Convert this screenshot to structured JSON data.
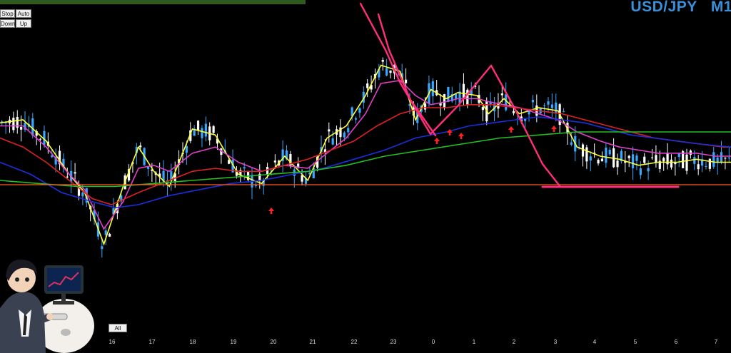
{
  "header": {
    "symbol": "USD/JPY",
    "timeframe": "M1"
  },
  "buttons": {
    "stop": "Stop",
    "auto": "Auto",
    "down": "Down",
    "up": "Up",
    "all": "All"
  },
  "colors": {
    "background": "#000000",
    "bull_candle": "#3aa7ff",
    "bear_candle": "#ffffff",
    "ma_yellow": "#ffff33",
    "ma_magenta": "#e040c8",
    "ma_red": "#e02020",
    "ma_blue": "#1a2fe0",
    "ma_green": "#22c022",
    "horizontal_line": "#ff5a1f",
    "annotation": "#ff2d7a",
    "arrows": "#ff2020"
  },
  "chart_data": {
    "type": "line",
    "description_axis": "x = position in bars, y = relative price level (0 bottom to 100 top)",
    "xticks": [
      "16",
      "17",
      "18",
      "19",
      "20",
      "21",
      "22",
      "23",
      "0",
      "1",
      "2",
      "3",
      "4",
      "5",
      "6",
      "7"
    ],
    "series": [
      {
        "name": "",
        "color": "#ffff33",
        "points": [
          [
            0,
            63
          ],
          [
            6,
            64
          ],
          [
            12,
            57
          ],
          [
            18,
            46
          ],
          [
            22,
            40
          ],
          [
            27,
            23
          ],
          [
            32,
            42
          ],
          [
            36,
            55
          ],
          [
            40,
            47
          ],
          [
            44,
            42
          ],
          [
            50,
            61
          ],
          [
            56,
            59
          ],
          [
            62,
            46
          ],
          [
            68,
            43
          ],
          [
            74,
            52
          ],
          [
            80,
            44
          ],
          [
            85,
            58
          ],
          [
            90,
            62
          ],
          [
            95,
            72
          ],
          [
            99,
            82
          ],
          [
            104,
            80
          ],
          [
            108,
            64
          ],
          [
            112,
            74
          ],
          [
            116,
            71
          ],
          [
            119,
            73
          ],
          [
            124,
            72
          ],
          [
            127,
            66
          ],
          [
            131,
            71
          ],
          [
            135,
            66
          ],
          [
            140,
            68
          ],
          [
            145,
            67
          ],
          [
            150,
            55
          ],
          [
            156,
            52
          ],
          [
            161,
            51
          ],
          [
            166,
            49
          ],
          [
            171,
            50
          ],
          [
            176,
            50
          ],
          [
            181,
            51
          ],
          [
            186,
            50
          ],
          [
            190,
            50
          ]
        ]
      },
      {
        "name": "",
        "color": "#e040c8",
        "points": [
          [
            0,
            62
          ],
          [
            6,
            62
          ],
          [
            12,
            55
          ],
          [
            18,
            46
          ],
          [
            22,
            41
          ],
          [
            27,
            28
          ],
          [
            32,
            37
          ],
          [
            36,
            48
          ],
          [
            40,
            49
          ],
          [
            44,
            47
          ],
          [
            50,
            53
          ],
          [
            56,
            55
          ],
          [
            62,
            50
          ],
          [
            68,
            47
          ],
          [
            74,
            49
          ],
          [
            80,
            48
          ],
          [
            85,
            53
          ],
          [
            90,
            58
          ],
          [
            95,
            66
          ],
          [
            99,
            76
          ],
          [
            104,
            77
          ],
          [
            108,
            72
          ],
          [
            112,
            69
          ],
          [
            116,
            70
          ],
          [
            119,
            71
          ],
          [
            124,
            71
          ],
          [
            127,
            70
          ],
          [
            131,
            69
          ],
          [
            135,
            68
          ],
          [
            140,
            66
          ],
          [
            145,
            64
          ],
          [
            150,
            60
          ],
          [
            156,
            57
          ],
          [
            161,
            55
          ],
          [
            166,
            54
          ],
          [
            171,
            53
          ],
          [
            176,
            53
          ],
          [
            181,
            53
          ],
          [
            186,
            52
          ],
          [
            190,
            52
          ]
        ]
      },
      {
        "name": "",
        "color": "#e02020",
        "points": [
          [
            0,
            58
          ],
          [
            6,
            55
          ],
          [
            12,
            50
          ],
          [
            18,
            44
          ],
          [
            24,
            38
          ],
          [
            29,
            36
          ],
          [
            36,
            40
          ],
          [
            44,
            44
          ],
          [
            50,
            47
          ],
          [
            56,
            48
          ],
          [
            62,
            47
          ],
          [
            68,
            47
          ],
          [
            74,
            49
          ],
          [
            80,
            51
          ],
          [
            86,
            54
          ],
          [
            92,
            57
          ],
          [
            98,
            62
          ],
          [
            104,
            66
          ],
          [
            110,
            68
          ],
          [
            116,
            68
          ],
          [
            122,
            69
          ],
          [
            128,
            69
          ],
          [
            134,
            68
          ],
          [
            140,
            67
          ],
          [
            146,
            66
          ],
          [
            152,
            64
          ],
          [
            158,
            62
          ],
          [
            164,
            60
          ],
          [
            170,
            58
          ],
          [
            176,
            57
          ],
          [
            182,
            56
          ],
          [
            188,
            55
          ],
          [
            190,
            55
          ]
        ]
      },
      {
        "name": "",
        "color": "#1a2fe0",
        "points": [
          [
            0,
            50
          ],
          [
            8,
            46
          ],
          [
            16,
            40
          ],
          [
            24,
            37
          ],
          [
            30,
            35
          ],
          [
            36,
            36
          ],
          [
            44,
            39
          ],
          [
            52,
            41
          ],
          [
            60,
            43
          ],
          [
            68,
            44
          ],
          [
            76,
            46
          ],
          [
            84,
            48
          ],
          [
            92,
            51
          ],
          [
            100,
            54
          ],
          [
            108,
            58
          ],
          [
            116,
            60
          ],
          [
            122,
            62
          ],
          [
            128,
            63
          ],
          [
            134,
            64
          ],
          [
            140,
            65
          ],
          [
            146,
            64
          ],
          [
            152,
            63
          ],
          [
            158,
            61
          ],
          [
            164,
            59
          ],
          [
            170,
            58
          ],
          [
            176,
            57
          ],
          [
            182,
            56
          ],
          [
            190,
            55
          ]
        ]
      },
      {
        "name": "",
        "color": "#22c022",
        "points": [
          [
            0,
            44
          ],
          [
            10,
            43
          ],
          [
            20,
            42
          ],
          [
            30,
            42
          ],
          [
            40,
            43
          ],
          [
            50,
            44
          ],
          [
            60,
            45
          ],
          [
            70,
            46
          ],
          [
            80,
            47
          ],
          [
            90,
            49
          ],
          [
            100,
            52
          ],
          [
            110,
            54
          ],
          [
            120,
            56
          ],
          [
            130,
            58
          ],
          [
            140,
            59
          ],
          [
            150,
            60
          ],
          [
            160,
            60
          ],
          [
            170,
            60
          ],
          [
            180,
            60
          ],
          [
            190,
            60
          ]
        ]
      }
    ]
  },
  "avatar": {
    "label": "All"
  }
}
